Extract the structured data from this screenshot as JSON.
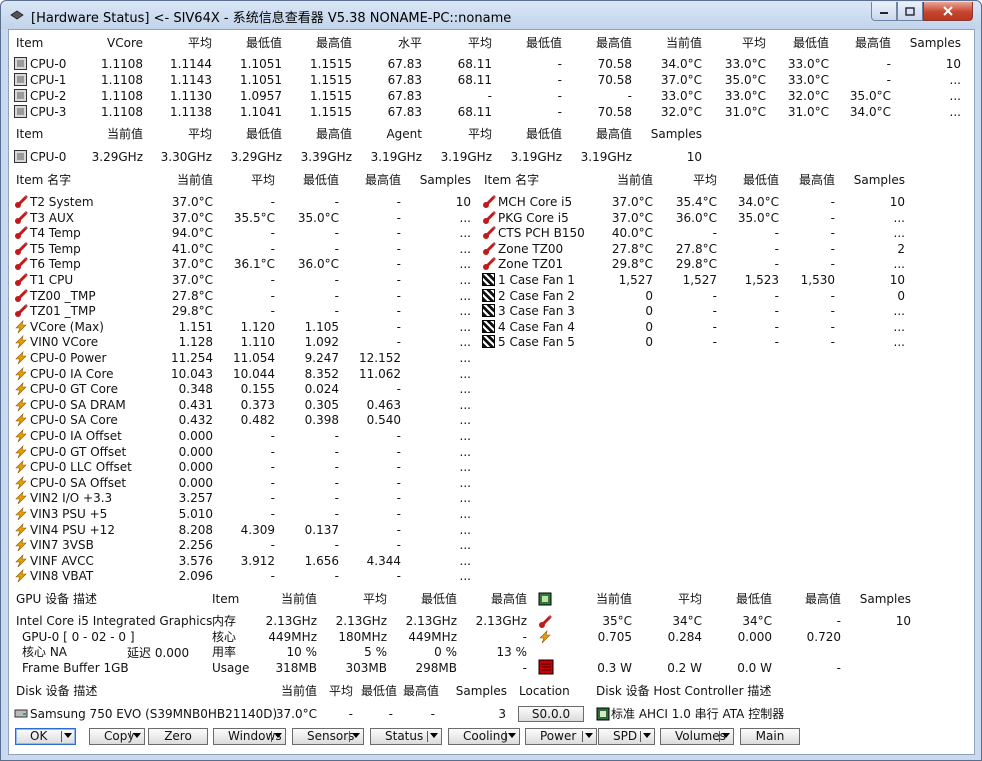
{
  "window": {
    "title": "[Hardware Status] <- SIV64X - 系统信息查看器 V5.38 NONAME-PC::noname"
  },
  "cpu_volt_temp": {
    "headers": [
      "Item",
      "VCore",
      "平均",
      "最低值",
      "最高值",
      "水平",
      "平均",
      "最低值",
      "最高值",
      "当前值",
      "平均",
      "最低值",
      "最高值",
      "Samples"
    ],
    "rows": [
      [
        "CPU-0",
        "1.1108",
        "1.1144",
        "1.1051",
        "1.1515",
        "67.83",
        "68.11",
        "-",
        "70.58",
        "34.0°C",
        "33.0°C",
        "33.0°C",
        "-",
        "10"
      ],
      [
        "CPU-1",
        "1.1108",
        "1.1143",
        "1.1051",
        "1.1515",
        "67.83",
        "68.11",
        "-",
        "70.58",
        "37.0°C",
        "35.0°C",
        "33.0°C",
        "-",
        "..."
      ],
      [
        "CPU-2",
        "1.1108",
        "1.1130",
        "1.0957",
        "1.1515",
        "67.83",
        "-",
        "-",
        "-",
        "33.0°C",
        "33.0°C",
        "32.0°C",
        "35.0°C",
        "..."
      ],
      [
        "CPU-3",
        "1.1108",
        "1.1138",
        "1.1041",
        "1.1515",
        "67.83",
        "68.11",
        "-",
        "70.58",
        "32.0°C",
        "31.0°C",
        "31.0°C",
        "34.0°C",
        "..."
      ]
    ]
  },
  "cpu_clock": {
    "headers": [
      "Item",
      "当前值",
      "平均",
      "最低值",
      "最高值",
      "Agent",
      "平均",
      "最低值",
      "最高值",
      "Samples"
    ],
    "rows": [
      [
        "CPU-0",
        "3.29GHz",
        "3.30GHz",
        "3.29GHz",
        "3.39GHz",
        "3.19GHz",
        "3.19GHz",
        "3.19GHz",
        "3.19GHz",
        "10"
      ]
    ]
  },
  "sensors_left": {
    "headers": [
      "Item 名字",
      "当前值",
      "平均",
      "最低值",
      "最高值",
      "Samples"
    ],
    "rows": [
      {
        "icon": "temp",
        "cells": [
          "T2 System",
          "37.0°C",
          "-",
          "-",
          "-",
          "10"
        ]
      },
      {
        "icon": "temp",
        "cells": [
          "T3 AUX",
          "37.0°C",
          "35.5°C",
          "35.0°C",
          "-",
          "..."
        ]
      },
      {
        "icon": "temp",
        "cells": [
          "T4 Temp",
          "94.0°C",
          "-",
          "-",
          "-",
          "..."
        ]
      },
      {
        "icon": "temp",
        "cells": [
          "T5 Temp",
          "41.0°C",
          "-",
          "-",
          "-",
          "..."
        ]
      },
      {
        "icon": "temp",
        "cells": [
          "T6 Temp",
          "37.0°C",
          "36.1°C",
          "36.0°C",
          "-",
          "..."
        ]
      },
      {
        "icon": "temp",
        "cells": [
          "T1 CPU",
          "37.0°C",
          "-",
          "-",
          "-",
          "..."
        ]
      },
      {
        "icon": "temp",
        "cells": [
          "TZ00 _TMP",
          "27.8°C",
          "-",
          "-",
          "-",
          "..."
        ]
      },
      {
        "icon": "temp",
        "cells": [
          "TZ01 _TMP",
          "29.8°C",
          "-",
          "-",
          "-",
          "..."
        ]
      },
      {
        "icon": "volt",
        "cells": [
          "VCore (Max)",
          "1.151",
          "1.120",
          "1.105",
          "-",
          "..."
        ]
      },
      {
        "icon": "volt",
        "cells": [
          "VIN0 VCore",
          "1.128",
          "1.110",
          "1.092",
          "-",
          "..."
        ]
      },
      {
        "icon": "volt",
        "cells": [
          "CPU-0 Power",
          "11.254",
          "11.054",
          "9.247",
          "12.152",
          "..."
        ]
      },
      {
        "icon": "volt",
        "cells": [
          "CPU-0 IA Core",
          "10.043",
          "10.044",
          "8.352",
          "11.062",
          "..."
        ]
      },
      {
        "icon": "volt",
        "cells": [
          "CPU-0 GT Core",
          "0.348",
          "0.155",
          "0.024",
          "-",
          "..."
        ]
      },
      {
        "icon": "volt",
        "cells": [
          "CPU-0 SA DRAM",
          "0.431",
          "0.373",
          "0.305",
          "0.463",
          "..."
        ]
      },
      {
        "icon": "volt",
        "cells": [
          "CPU-0 SA Core",
          "0.432",
          "0.482",
          "0.398",
          "0.540",
          "..."
        ]
      },
      {
        "icon": "volt",
        "cells": [
          "CPU-0 IA Offset",
          "0.000",
          "-",
          "-",
          "-",
          "..."
        ]
      },
      {
        "icon": "volt",
        "cells": [
          "CPU-0 GT Offset",
          "0.000",
          "-",
          "-",
          "-",
          "..."
        ]
      },
      {
        "icon": "volt",
        "cells": [
          "CPU-0 LLC Offset",
          "0.000",
          "-",
          "-",
          "-",
          "..."
        ]
      },
      {
        "icon": "volt",
        "cells": [
          "CPU-0 SA Offset",
          "0.000",
          "-",
          "-",
          "-",
          "..."
        ]
      },
      {
        "icon": "volt",
        "cells": [
          "VIN2 I/O +3.3",
          "3.257",
          "-",
          "-",
          "-",
          "..."
        ]
      },
      {
        "icon": "volt",
        "cells": [
          "VIN3 PSU +5",
          "5.010",
          "-",
          "-",
          "-",
          "..."
        ]
      },
      {
        "icon": "volt",
        "cells": [
          "VIN4 PSU +12",
          "8.208",
          "4.309",
          "0.137",
          "-",
          "..."
        ]
      },
      {
        "icon": "volt",
        "cells": [
          "VIN7 3VSB",
          "2.256",
          "-",
          "-",
          "-",
          "..."
        ]
      },
      {
        "icon": "volt",
        "cells": [
          "VINF AVCC",
          "3.576",
          "3.912",
          "1.656",
          "4.344",
          "..."
        ]
      },
      {
        "icon": "volt",
        "cells": [
          "VIN8 VBAT",
          "2.096",
          "-",
          "-",
          "-",
          "..."
        ]
      }
    ]
  },
  "sensors_right": {
    "headers": [
      "Item 名字",
      "当前值",
      "平均",
      "最低值",
      "最高值",
      "Samples"
    ],
    "rows": [
      {
        "icon": "temp",
        "cells": [
          "MCH Core i5",
          "37.0°C",
          "35.4°C",
          "34.0°C",
          "-",
          "10"
        ]
      },
      {
        "icon": "temp",
        "cells": [
          "PKG Core i5",
          "37.0°C",
          "36.0°C",
          "35.0°C",
          "-",
          "..."
        ]
      },
      {
        "icon": "temp",
        "cells": [
          "CTS PCH B150",
          "40.0°C",
          "-",
          "-",
          "-",
          "..."
        ]
      },
      {
        "icon": "temp",
        "cells": [
          "Zone TZ00",
          "27.8°C",
          "27.8°C",
          "-",
          "-",
          "2"
        ]
      },
      {
        "icon": "temp",
        "cells": [
          "Zone TZ01",
          "29.8°C",
          "29.8°C",
          "-",
          "-",
          "..."
        ]
      },
      {
        "icon": "fan",
        "cells": [
          "1 Case Fan 1",
          "1,527",
          "1,527",
          "1,523",
          "1,530",
          "10"
        ]
      },
      {
        "icon": "fan",
        "cells": [
          "2 Case Fan 2",
          "0",
          "-",
          "-",
          "-",
          "0"
        ]
      },
      {
        "icon": "fan",
        "cells": [
          "3 Case Fan 3",
          "0",
          "-",
          "-",
          "-",
          "..."
        ]
      },
      {
        "icon": "fan",
        "cells": [
          "4 Case Fan 4",
          "0",
          "-",
          "-",
          "-",
          "..."
        ]
      },
      {
        "icon": "fan",
        "cells": [
          "5 Case Fan 5",
          "0",
          "-",
          "-",
          "-",
          "..."
        ]
      }
    ]
  },
  "gpu": {
    "headers_left": [
      "GPU 设备 描述",
      "Item",
      "当前值",
      "平均",
      "最低值",
      "最高值"
    ],
    "headers_right": [
      "当前值",
      "平均",
      "最低值",
      "最高值",
      "Samples"
    ],
    "desc": [
      "Intel Core i5 Integrated Graphics",
      "GPU-0 [ 0 - 02 - 0 ]",
      "核心 NA",
      "Frame Buffer 1GB"
    ],
    "delay_label": "延迟 0.000",
    "rows": [
      [
        "内存",
        "2.13GHz",
        "2.13GHz",
        "2.13GHz",
        "2.13GHz"
      ],
      [
        "核心",
        "449MHz",
        "180MHz",
        "449MHz",
        "-"
      ],
      [
        "用率",
        "10 %",
        "5 %",
        "0 %",
        "13 %"
      ],
      [
        "Usage",
        "318MB",
        "303MB",
        "298MB",
        "-"
      ]
    ],
    "right_rows": [
      [
        "35°C",
        "34°C",
        "34°C",
        "-",
        "10"
      ],
      [
        "0.705",
        "0.284",
        "0.000",
        "0.720",
        ""
      ],
      [
        "",
        "",
        "",
        "",
        ""
      ],
      [
        "0.3 W",
        "0.2 W",
        "0.0 W",
        "-",
        ""
      ]
    ]
  },
  "disk": {
    "headers": [
      "Disk 设备 描述",
      "当前值",
      "平均",
      "最低值",
      "最高值",
      "Samples",
      "Location",
      "Disk 设备 Host Controller 描述"
    ],
    "row": [
      "Samsung 750 EVO (S39MNB0HB21140D)",
      "37.0°C",
      "-",
      "-",
      "-",
      "3",
      "S0.0.0",
      "标准 AHCI 1.0 串行 ATA 控制器"
    ]
  },
  "buttons": [
    {
      "label": "OK",
      "dropdown": true
    },
    {
      "label": "Copy",
      "dropdown": true
    },
    {
      "label": "Zero",
      "dropdown": false
    },
    {
      "label": "Windows",
      "dropdown": true
    },
    {
      "label": "Sensors",
      "dropdown": true
    },
    {
      "label": "Status",
      "dropdown": true
    },
    {
      "label": "Cooling",
      "dropdown": true
    },
    {
      "label": "Power",
      "dropdown": true
    },
    {
      "label": "SPD",
      "dropdown": true
    },
    {
      "label": "Volumes",
      "dropdown": true
    },
    {
      "label": "Main",
      "dropdown": false
    }
  ],
  "colors": {
    "title_bg": "#c9d9ee",
    "close_red": "#c7452f",
    "temp_red": "#c21a1a",
    "volt_orange": "#e8a000"
  }
}
